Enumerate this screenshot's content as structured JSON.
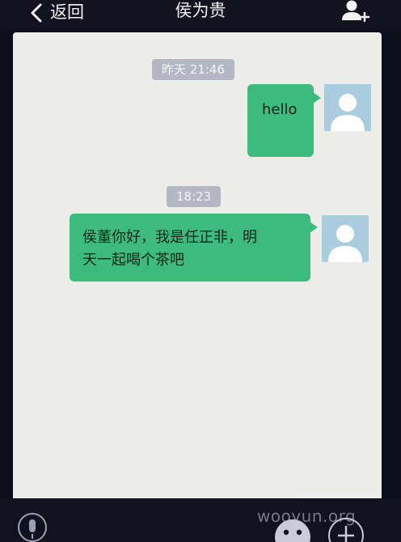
{
  "header": {
    "back_label": "返回",
    "title": "侯为贵",
    "back_icon": "chevron-left-icon",
    "action_icon": "add-contact-icon"
  },
  "messages": [
    {
      "timestamp": "昨天 21:46",
      "text": "hello",
      "sender": "self"
    },
    {
      "timestamp": "18:23",
      "text_lines": [
        "侯董你好，我是任正非，明",
        "天一起喝个茶吧"
      ],
      "sender": "self"
    }
  ],
  "footer": {
    "icons": [
      "microphone-icon",
      "emoji-icon",
      "plus-icon"
    ]
  },
  "watermark": "wooyun.org",
  "colors": {
    "bubble": "#3dba7d",
    "chat_background": "#ecede9",
    "timestamp_background": "#b3b8c4",
    "avatar": "#a9ccde",
    "bar": "#11141f"
  }
}
